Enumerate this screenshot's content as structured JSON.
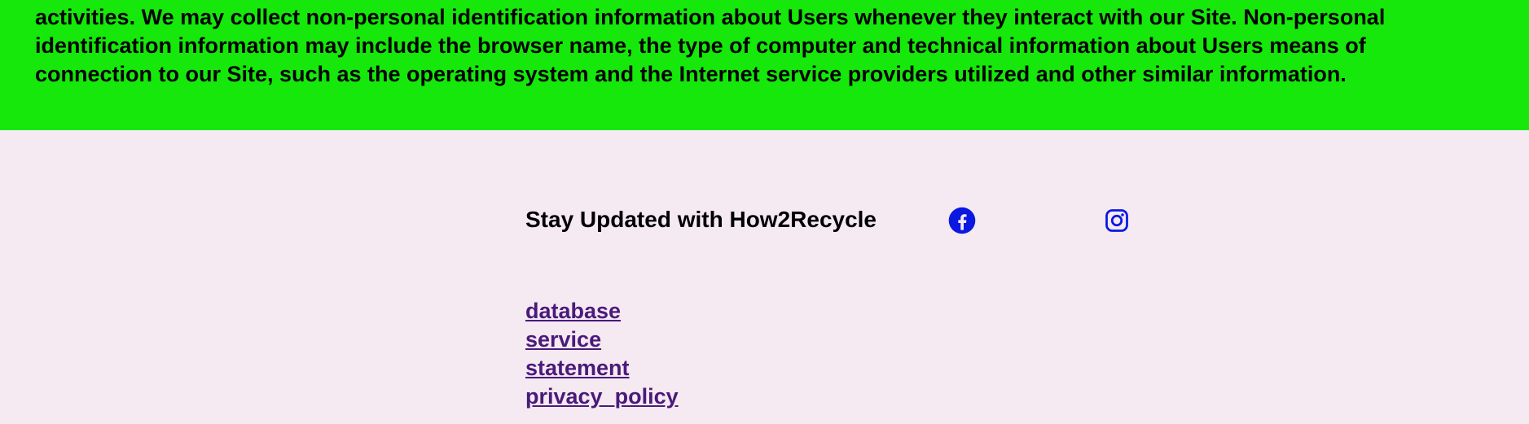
{
  "privacy_section": {
    "partial_top_line": "activities. We may collect non-personal identification information about Users whenever they interact with our Site. Non-personal identification information may include the browser name, the type of computer and technical information about Users means of",
    "lines": [
      "activities. We may collect non-personal identification information about Users whenever they interact with our Site. Non-personal",
      "identification information may include the browser name, the type of computer and technical information about Users means of",
      "connection to our Site, such as the operating system and the Internet service providers utilized and other similar information."
    ]
  },
  "footer": {
    "title": "Stay Updated with How2Recycle",
    "social": [
      {
        "icon": "facebook-icon"
      },
      {
        "icon": "instagram-icon"
      }
    ],
    "links": [
      "database",
      "service",
      "statement",
      "privacy_policy"
    ]
  },
  "colors": {
    "green_band": "#15e80a",
    "footer_bg": "#f5e9f2",
    "social_icon": "#0a18e0",
    "link": "#4a1a7a"
  }
}
